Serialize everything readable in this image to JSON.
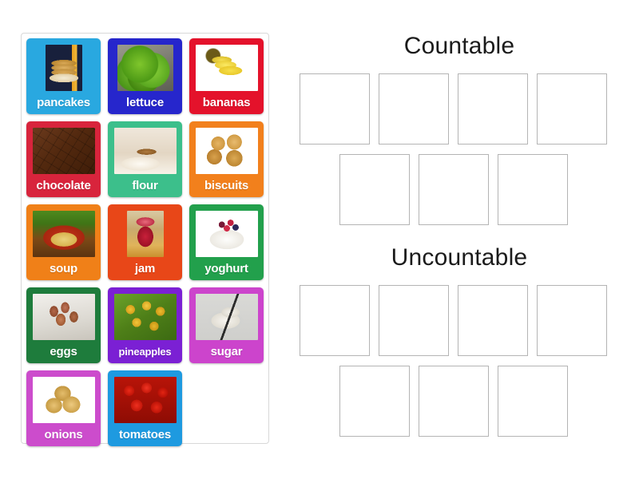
{
  "activity": {
    "type": "group-sort",
    "tray_label": "word tiles"
  },
  "tiles": [
    {
      "id": "pancakes",
      "label": "pancakes",
      "color": "#29a8e0",
      "photo": "ph-pancakes",
      "photo_size": "tall"
    },
    {
      "id": "lettuce",
      "label": "lettuce",
      "color": "#2626cc",
      "photo": "ph-lettuce",
      "photo_size": "normal"
    },
    {
      "id": "bananas",
      "label": "bananas",
      "color": "#e4122b",
      "photo": "ph-bananas",
      "photo_size": "wide"
    },
    {
      "id": "chocolate",
      "label": "chocolate",
      "color": "#d8243c",
      "photo": "ph-chocolate",
      "photo_size": "wide"
    },
    {
      "id": "flour",
      "label": "flour",
      "color": "#3cbf8b",
      "photo": "ph-flour",
      "photo_size": "wide"
    },
    {
      "id": "biscuits",
      "label": "biscuits",
      "color": "#f2801c",
      "photo": "ph-biscuits",
      "photo_size": "wide"
    },
    {
      "id": "soup",
      "label": "soup",
      "color": "#f08018",
      "photo": "ph-soup",
      "photo_size": "wide"
    },
    {
      "id": "jam",
      "label": "jam",
      "color": "#e84718",
      "photo": "ph-jam",
      "photo_size": "tall"
    },
    {
      "id": "yoghurt",
      "label": "yoghurt",
      "color": "#22a04c",
      "photo": "ph-yoghurt",
      "photo_size": "wide"
    },
    {
      "id": "eggs",
      "label": "eggs",
      "color": "#1e7c3c",
      "photo": "ph-eggs",
      "photo_size": "wide"
    },
    {
      "id": "pineapples",
      "label": "pineapples",
      "color": "#7b20d4",
      "photo": "ph-pineapples",
      "photo_size": "wide"
    },
    {
      "id": "sugar",
      "label": "sugar",
      "color": "#cc44cc",
      "photo": "ph-sugar",
      "photo_size": "wide"
    },
    {
      "id": "onions",
      "label": "onions",
      "color": "#cc4ccc",
      "photo": "ph-onions",
      "photo_size": "wide"
    },
    {
      "id": "tomatoes",
      "label": "tomatoes",
      "color": "#1e9ae0",
      "photo": "ph-tomatoes",
      "photo_size": "wide"
    }
  ],
  "categories": [
    {
      "id": "countable",
      "title": "Countable",
      "row_1_slots": 4,
      "row_2_slots": 3,
      "slots": [
        "",
        "",
        "",
        "",
        "",
        "",
        ""
      ]
    },
    {
      "id": "uncountable",
      "title": "Uncountable",
      "row_1_slots": 4,
      "row_2_slots": 3,
      "slots": [
        "",
        "",
        "",
        "",
        "",
        "",
        ""
      ]
    }
  ],
  "colors": {
    "page_background": "#ffffff",
    "tray_border": "#d8d8d8",
    "slot_border": "#b4b4b4",
    "title_text": "#1b1b1b",
    "tile_label_text": "#ffffff"
  }
}
